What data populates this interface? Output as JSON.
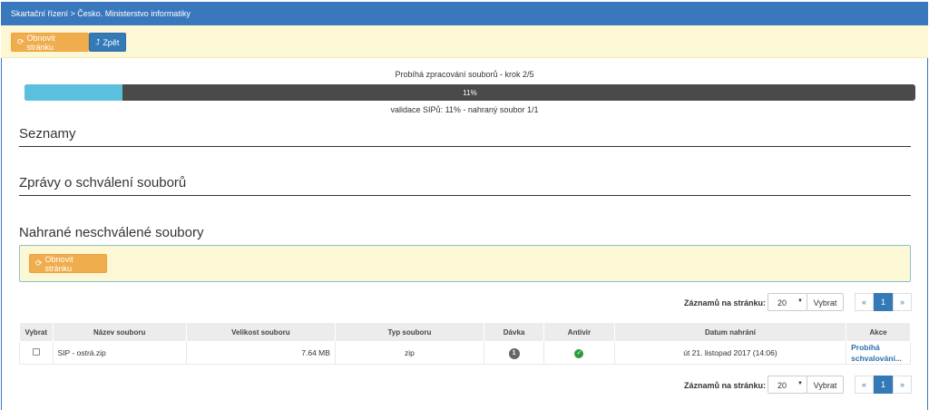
{
  "header": {
    "breadcrumb": "Skartační řízení > Česko. Ministerstvo informatiky"
  },
  "toolbar": {
    "refresh_label": "Obnovit stránku",
    "back_label": "Zpět"
  },
  "progress": {
    "step_text": "Probíhá zpracování souborů - krok 2/5",
    "percent": 11,
    "percent_label": "11%",
    "note": "validace SIPů: 11% - nahraný soubor 1/1"
  },
  "sections": {
    "lists": "Seznamy",
    "approval_messages": "Zprávy o schválení souborů",
    "unapproved_files": "Nahrané neschválené soubory"
  },
  "panel": {
    "refresh_label": "Obnovit stránku"
  },
  "pager": {
    "label": "Záznamů na stránku:",
    "per_page": "20",
    "select_label": "Vybrat",
    "prev": "«",
    "current_page": "1",
    "next": "»"
  },
  "table": {
    "columns": [
      "Vybrat",
      "Název souboru",
      "Velikost souboru",
      "Typ souboru",
      "Dávka",
      "Antivir",
      "Datum nahrání",
      "Akce"
    ],
    "rows": [
      {
        "name": "SIP - ostrá.zip",
        "size": "7.64 MB",
        "type": "zip",
        "batch": "1",
        "date": "út 21. listopad 2017 (14:06)",
        "action_line1": "Probíhá",
        "action_line2": "schvalování..."
      }
    ]
  },
  "colors": {
    "header": "#3a78bd",
    "toolbar_bg": "#fcf8d6",
    "orange": "#f0ad4e",
    "blue": "#337ab7",
    "progress_fill": "#5bc0de",
    "progress_track": "#4a4a4a",
    "antivirus_ok": "#2a9d3a"
  },
  "icons": {
    "refresh": "refresh-icon",
    "back": "back-arrow-icon",
    "antivirus": "check-circle-icon"
  }
}
